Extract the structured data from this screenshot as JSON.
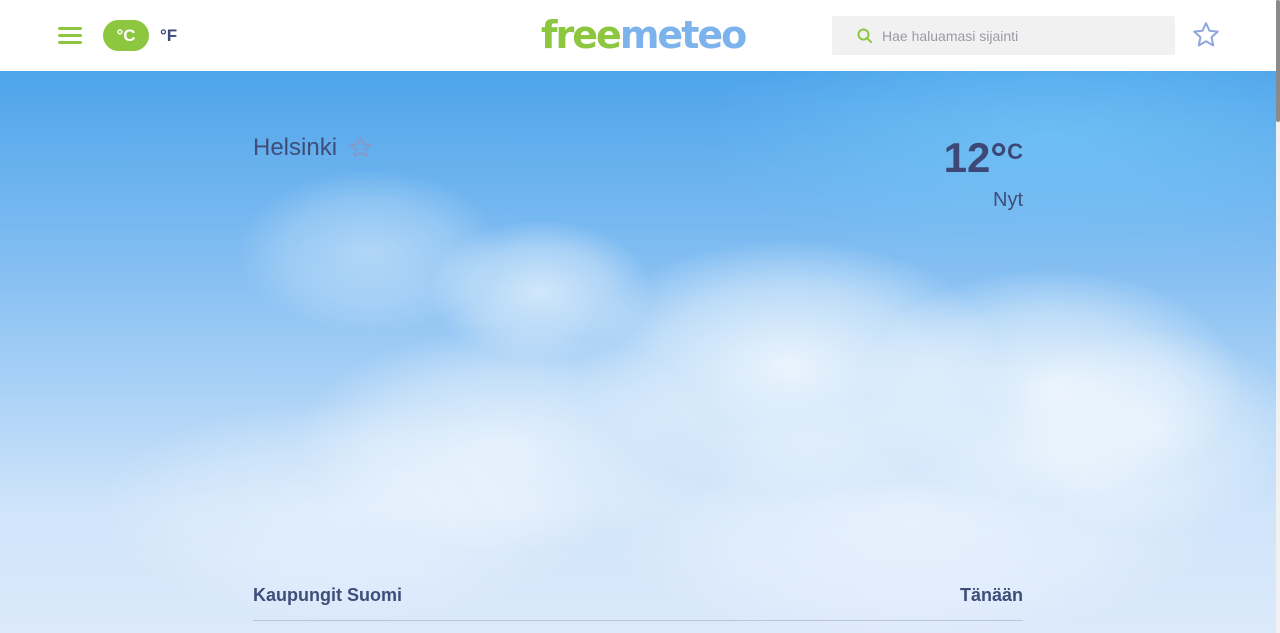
{
  "header": {
    "menu_icon": "hamburger-menu-icon",
    "unit_celsius_label": "°C",
    "unit_fahrenheit_label": "°F",
    "logo_part1": "free",
    "logo_part2": "meteo",
    "search_placeholder": "Hae haluamasi sijainti",
    "search_value": "",
    "search_icon": "search-icon",
    "favorites_icon": "star-outline-icon"
  },
  "current": {
    "city": "Helsinki",
    "favorite_icon": "star-outline-icon",
    "temperature": "12°",
    "temperature_unit": "C",
    "time_label": "Nyt"
  },
  "cities_section": {
    "title": "Kaupungit Suomi",
    "day_label": "Tänään"
  },
  "colors": {
    "brand_green": "#8dc63f",
    "brand_blue": "#7cb3ec",
    "text_navy": "#3f4d79",
    "sky_top": "#4ea4ea",
    "sky_bottom": "#dce9fb"
  }
}
